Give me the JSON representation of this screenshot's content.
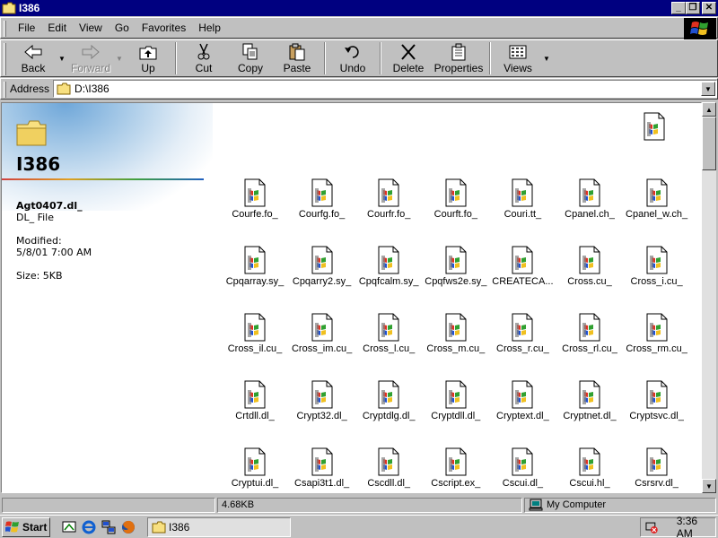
{
  "window": {
    "title": "I386"
  },
  "menu": [
    "File",
    "Edit",
    "View",
    "Go",
    "Favorites",
    "Help"
  ],
  "toolbar": {
    "back": "Back",
    "forward": "Forward",
    "up": "Up",
    "cut": "Cut",
    "copy": "Copy",
    "paste": "Paste",
    "undo": "Undo",
    "delete": "Delete",
    "properties": "Properties",
    "views": "Views"
  },
  "address": {
    "label": "Address",
    "value": "D:\\I386"
  },
  "sidebar": {
    "folder_name": "I386",
    "selected_name": "Agt0407.dl_",
    "selected_type": "DL_ File",
    "modified_label": "Modified:",
    "modified_value": "5/8/01 7:00 AM",
    "size": "Size: 5KB"
  },
  "files": [
    "Courfe.fo_",
    "Courfg.fo_",
    "Courfr.fo_",
    "Courft.fo_",
    "Couri.tt_",
    "Cpanel.ch_",
    "Cpanel_w.ch_",
    "Cpqarray.sy_",
    "Cpqarry2.sy_",
    "Cpqfcalm.sy_",
    "Cpqfws2e.sy_",
    "CREATECA...",
    "Cross.cu_",
    "Cross_i.cu_",
    "Cross_il.cu_",
    "Cross_im.cu_",
    "Cross_l.cu_",
    "Cross_m.cu_",
    "Cross_r.cu_",
    "Cross_rl.cu_",
    "Cross_rm.cu_",
    "Crtdll.dl_",
    "Crypt32.dl_",
    "Cryptdlg.dl_",
    "Cryptdll.dl_",
    "Cryptext.dl_",
    "Cryptnet.dl_",
    "Cryptsvc.dl_",
    "Cryptui.dl_",
    "Csapi3t1.dl_",
    "Cscdll.dl_",
    "Cscript.ex_",
    "Cscui.dl_",
    "Cscui.hl_",
    "Csrsrv.dl_"
  ],
  "status": {
    "size": "4.68KB",
    "zone": "My Computer"
  },
  "taskbar": {
    "start": "Start",
    "task": "I386",
    "clock": "3:36 AM"
  }
}
